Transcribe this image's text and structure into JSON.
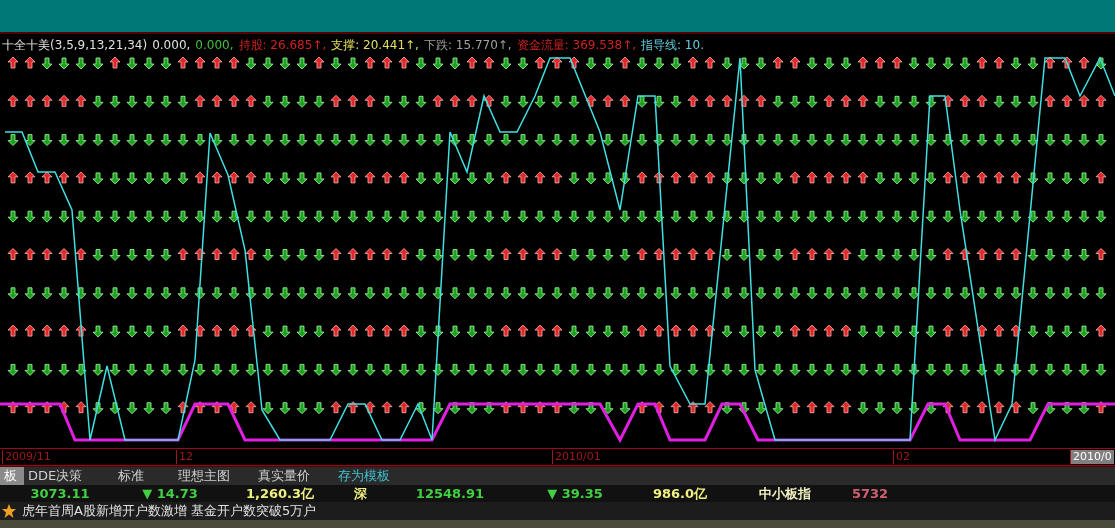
{
  "legend": [
    {
      "text": "十全十美(3,5,9,13,21,34)",
      "color": "#e0e0e0"
    },
    {
      "text": "0.000,",
      "color": "#e0e0e0"
    },
    {
      "text": "0.000,",
      "color": "#40c040"
    },
    {
      "text": "持股: 26.685↑,",
      "color": "#d02020"
    },
    {
      "text": "支撑: 20.441↑,",
      "color": "#e0e060"
    },
    {
      "text": "下跌: 15.770↑,",
      "color": "#a0a0a0"
    },
    {
      "text": "资金流量: 369.538↑,",
      "color": "#d02020"
    },
    {
      "text": "指导线: 10.",
      "color": "#60d0e0"
    }
  ],
  "date_axis": [
    {
      "label": "2009/11",
      "selected": false
    },
    {
      "label": "12",
      "selected": false
    },
    {
      "label": "2010/01",
      "selected": false
    },
    {
      "label": "02",
      "selected": false
    },
    {
      "label": "2010/0",
      "selected": true
    }
  ],
  "tabs": [
    {
      "label": "板",
      "selected": true
    },
    {
      "label": "DDE决策",
      "selected": false
    },
    {
      "label": "标准",
      "selected": false
    },
    {
      "label": "理想主图",
      "selected": false
    },
    {
      "label": "真实量价",
      "selected": false
    },
    {
      "label": "存为模板",
      "selected": false
    }
  ],
  "ticker": [
    {
      "text": "3073.11",
      "color": "#40d040"
    },
    {
      "text": "▼ 14.73",
      "color": "#40d040"
    },
    {
      "text": "1,260.3亿",
      "color": "#f0f080"
    },
    {
      "text": "深",
      "color": "#f0f080"
    },
    {
      "text": "12548.91",
      "color": "#40d040"
    },
    {
      "text": "▼ 39.35",
      "color": "#40d040"
    },
    {
      "text": "986.0亿",
      "color": "#f0f080"
    },
    {
      "text": "中小板指",
      "color": "#f0f0c0"
    },
    {
      "text": "5732",
      "color": "#d06070"
    }
  ],
  "news": "虎年首周A股新增开户数激增 基金开户数突破5万户"
}
